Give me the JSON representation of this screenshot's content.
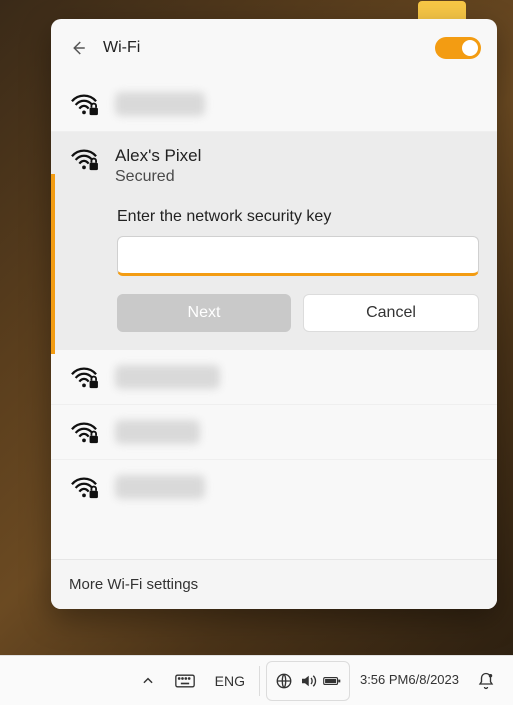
{
  "panel": {
    "title": "Wi-Fi",
    "toggle_on": true
  },
  "selected_network": {
    "name": "Alex's Pixel",
    "status": "Secured",
    "prompt": "Enter the network security key",
    "password_value": "",
    "next_label": "Next",
    "cancel_label": "Cancel"
  },
  "more_settings_label": "More Wi-Fi settings",
  "taskbar": {
    "lang": "ENG",
    "time": "3:56 PM",
    "date": "6/8/2023"
  },
  "icons": {
    "back": "back-arrow-icon",
    "wifi_secured": "wifi-secured-icon",
    "chevron_up": "chevron-up-icon",
    "keyboard": "touch-keyboard-icon",
    "network": "network-icon",
    "volume": "volume-icon",
    "battery": "battery-icon",
    "notifications": "notifications-icon"
  }
}
